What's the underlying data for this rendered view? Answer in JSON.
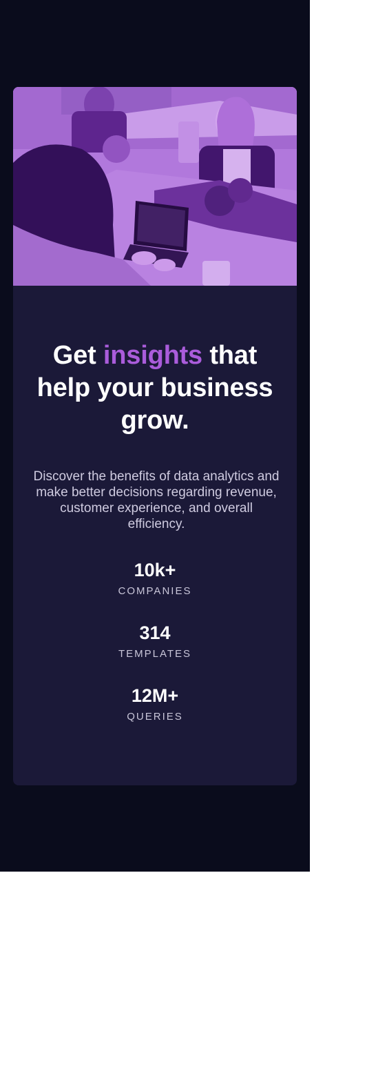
{
  "hero": {
    "image_subject": "people working at a table with laptops, purple tinted photo",
    "tint_color": "#aa5cdb"
  },
  "headline": {
    "before": "Get ",
    "accent": "insights",
    "after": " that help your business grow."
  },
  "description": "Discover the benefits of data analytics and make better decisions regarding revenue, customer experience, and overall efficiency.",
  "stats": [
    {
      "value": "10k+",
      "label": "COMPANIES"
    },
    {
      "value": "314",
      "label": "TEMPLATES"
    },
    {
      "value": "12M+",
      "label": "QUERIES"
    }
  ],
  "colors": {
    "page_bg": "#0a0c1c",
    "card_bg": "#1b1938",
    "accent": "#aa5cdb",
    "text": "#ffffff",
    "muted_text": "#cfcbe0"
  }
}
